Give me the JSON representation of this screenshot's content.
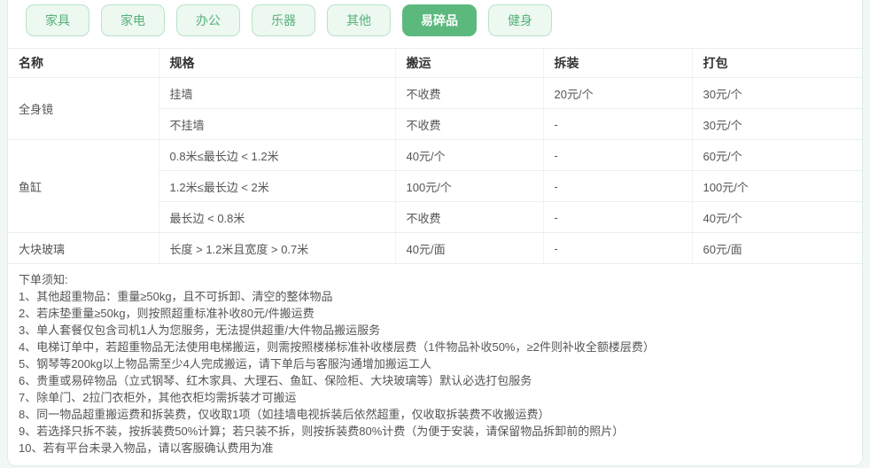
{
  "colors": {
    "page_background": "#f3f7f4",
    "card_background": "#ffffff",
    "card_border": "#e2ede7",
    "tab_active_background": "#5cb97e",
    "tab_active_text": "#ffffff",
    "tab_inactive_background": "#edf8f1",
    "tab_inactive_border": "#b9e2c8",
    "tab_inactive_text": "#55b178",
    "table_line": "#e9efec",
    "header_text": "#333333",
    "body_text": "#555555"
  },
  "tabs": [
    {
      "label": "家具",
      "active": false
    },
    {
      "label": "家电",
      "active": false
    },
    {
      "label": "办公",
      "active": false
    },
    {
      "label": "乐器",
      "active": false
    },
    {
      "label": "其他",
      "active": false
    },
    {
      "label": "易碎品",
      "active": true
    },
    {
      "label": "健身",
      "active": false
    }
  ],
  "table": {
    "headers": [
      "名称",
      "规格",
      "搬运",
      "拆装",
      "打包"
    ],
    "groups": [
      {
        "name": "全身镜",
        "rows": [
          {
            "spec": "挂墙",
            "carry": "不收费",
            "disassembly": "20元/个",
            "pack": "30元/个"
          },
          {
            "spec": "不挂墙",
            "carry": "不收费",
            "disassembly": "-",
            "pack": "30元/个"
          }
        ]
      },
      {
        "name": "鱼缸",
        "rows": [
          {
            "spec": "0.8米≤最长边 < 1.2米",
            "carry": "40元/个",
            "disassembly": "-",
            "pack": "60元/个"
          },
          {
            "spec": "1.2米≤最长边 < 2米",
            "carry": "100元/个",
            "disassembly": "-",
            "pack": "100元/个"
          },
          {
            "spec": "最长边 < 0.8米",
            "carry": "不收费",
            "disassembly": "-",
            "pack": "40元/个"
          }
        ]
      },
      {
        "name": "大块玻璃",
        "rows": [
          {
            "spec": "长度 > 1.2米且宽度 > 0.7米",
            "carry": "40元/面",
            "disassembly": "-",
            "pack": "60元/面"
          }
        ]
      }
    ]
  },
  "notes": {
    "title": "下单须知:",
    "items": [
      "1、其他超重物品：重量≥50kg，且不可拆卸、清空的整体物品",
      "2、若床垫重量≥50kg，则按照超重标准补收80元/件搬运费",
      "3、单人套餐仅包含司机1人为您服务，无法提供超重/大件物品搬运服务",
      "4、电梯订单中，若超重物品无法使用电梯搬运，则需按照楼梯标准补收楼层费（1件物品补收50%，≥2件则补收全额楼层费）",
      "5、钢琴等200kg以上物品需至少4人完成搬运，请下单后与客服沟通增加搬运工人",
      "6、贵重或易碎物品（立式钢琴、红木家具、大理石、鱼缸、保险柜、大块玻璃等）默认必选打包服务",
      "7、除单门、2拉门衣柜外，其他衣柜均需拆装才可搬运",
      "8、同一物品超重搬运费和拆装费，仅收取1项（如挂墙电视拆装后依然超重，仅收取拆装费不收搬运费）",
      "9、若选择只拆不装，按拆装费50%计算；若只装不拆，则按拆装费80%计费（为便于安装，请保留物品拆卸前的照片）",
      "10、若有平台未录入物品，请以客服确认费用为准"
    ]
  }
}
